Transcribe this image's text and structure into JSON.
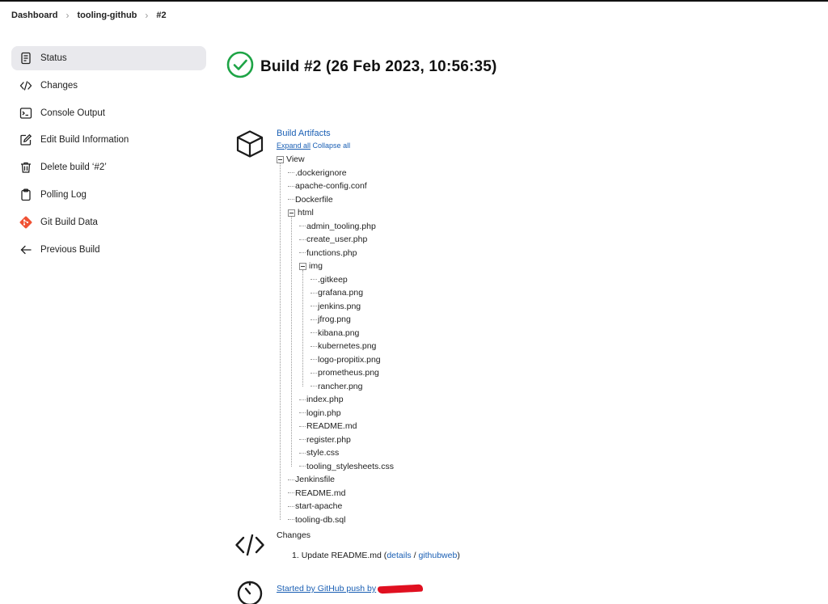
{
  "breadcrumb": {
    "items": [
      "Dashboard",
      "tooling-github",
      "#2"
    ]
  },
  "sidebar": {
    "items": [
      {
        "label": "Status",
        "icon": "document-icon"
      },
      {
        "label": "Changes",
        "icon": "code-icon"
      },
      {
        "label": "Console Output",
        "icon": "terminal-icon"
      },
      {
        "label": "Edit Build Information",
        "icon": "edit-icon"
      },
      {
        "label": "Delete build ‘#2’",
        "icon": "trash-icon"
      },
      {
        "label": "Polling Log",
        "icon": "clipboard-icon"
      },
      {
        "label": "Git Build Data",
        "icon": "git-icon"
      },
      {
        "label": "Previous Build",
        "icon": "arrow-left-icon"
      }
    ]
  },
  "build": {
    "title": "Build #2 (26 Feb 2023, 10:56:35)",
    "status_color": "#1ea446"
  },
  "artifacts": {
    "title": "Build Artifacts",
    "expand_all": "Expand all",
    "collapse_all": "Collapse all",
    "tree": [
      {
        "name": "View",
        "depth": 0,
        "folder": true
      },
      {
        "name": ".dockerignore",
        "depth": 1
      },
      {
        "name": "apache-config.conf",
        "depth": 1
      },
      {
        "name": "Dockerfile",
        "depth": 1
      },
      {
        "name": "html",
        "depth": 1,
        "folder": true
      },
      {
        "name": "admin_tooling.php",
        "depth": 2
      },
      {
        "name": "create_user.php",
        "depth": 2
      },
      {
        "name": "functions.php",
        "depth": 2
      },
      {
        "name": "img",
        "depth": 2,
        "folder": true
      },
      {
        "name": ".gitkeep",
        "depth": 3
      },
      {
        "name": "grafana.png",
        "depth": 3
      },
      {
        "name": "jenkins.png",
        "depth": 3
      },
      {
        "name": "jfrog.png",
        "depth": 3
      },
      {
        "name": "kibana.png",
        "depth": 3
      },
      {
        "name": "kubernetes.png",
        "depth": 3
      },
      {
        "name": "logo-propitix.png",
        "depth": 3
      },
      {
        "name": "prometheus.png",
        "depth": 3
      },
      {
        "name": "rancher.png",
        "depth": 3
      },
      {
        "name": "index.php",
        "depth": 2
      },
      {
        "name": "login.php",
        "depth": 2
      },
      {
        "name": "README.md",
        "depth": 2
      },
      {
        "name": "register.php",
        "depth": 2
      },
      {
        "name": "style.css",
        "depth": 2
      },
      {
        "name": "tooling_stylesheets.css",
        "depth": 2
      },
      {
        "name": "Jenkinsfile",
        "depth": 1
      },
      {
        "name": "README.md",
        "depth": 1
      },
      {
        "name": "start-apache",
        "depth": 1
      },
      {
        "name": "tooling-db.sql",
        "depth": 1
      }
    ]
  },
  "changes": {
    "title": "Changes",
    "item_number": "1.",
    "item_text": "Update README.md (",
    "details": "details",
    "separator": " / ",
    "githubweb": "githubweb",
    "close": ")"
  },
  "started": {
    "text": "Started by GitHub push by"
  }
}
